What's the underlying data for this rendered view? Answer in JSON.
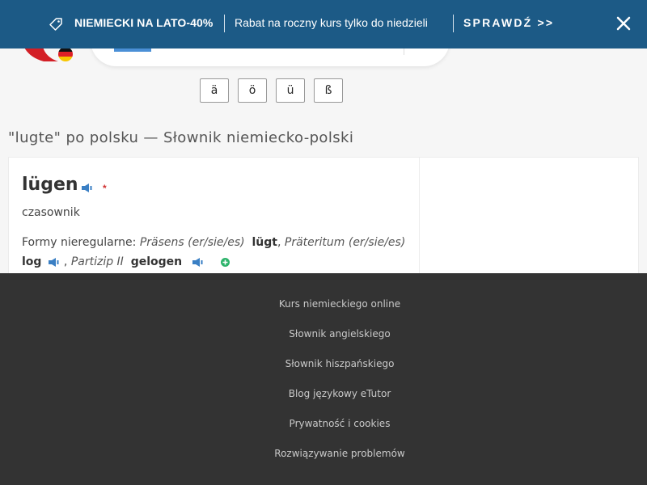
{
  "promo": {
    "title": "NIEMIECKI NA LATO-40%",
    "description": "Rabat na roczny kurs tylko do niedzieli",
    "cta": "SPRAWDŹ >>",
    "tag_icon": "tag-icon",
    "close_icon": "close-icon"
  },
  "special_chars": [
    "ä",
    "ö",
    "ü",
    "ß"
  ],
  "page_title": "\"lugte\" po polsku — Słownik niemiecko-polski",
  "entry": {
    "headword": "lügen",
    "asterisk": "*",
    "part_of_speech": "czasownik",
    "forms_label": "Formy nieregularne:",
    "form1_label": "Präsens (er/sie/es)",
    "form1_value": "lügt",
    "form2_label": "Präteritum (er/sie/es)",
    "form2_value": "log",
    "form3_label": "Partizip II",
    "form3_value": "gelogen"
  },
  "footer": {
    "links": [
      "Kurs niemieckiego online",
      "Słownik angielskiego",
      "Słownik hiszpańskiego",
      "Blog językowy eTutor",
      "Prywatność i cookies",
      "Rozwiązywanie problemów"
    ]
  },
  "colors": {
    "banner": "#1c5a86",
    "footer": "#333333",
    "speaker": "#3a7fc4",
    "plus": "#2db36b",
    "asterisk": "#d03030"
  }
}
